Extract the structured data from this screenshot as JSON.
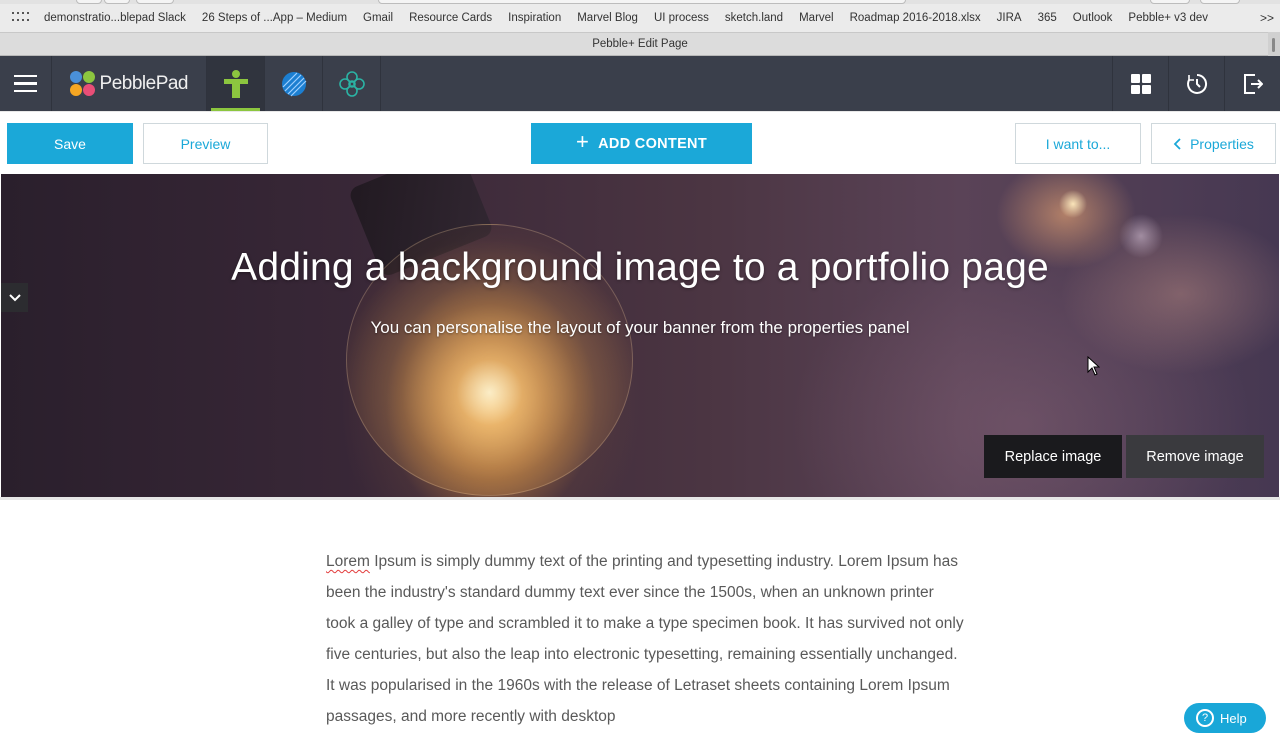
{
  "browser": {
    "bookmarks": [
      "demonstratio...blepad Slack",
      "26 Steps of ...App – Medium",
      "Gmail",
      "Resource Cards",
      "Inspiration",
      "Marvel Blog",
      "UI process",
      "sketch.land",
      "Marvel",
      "Roadmap 2016-2018.xlsx",
      "JIRA",
      "365",
      "Outlook",
      "Pebble+ v3 dev"
    ],
    "more": ">>",
    "tab_title": "Pebble+ Edit Page"
  },
  "header": {
    "logo_text": "PebblePad",
    "logo_colors": [
      "#4a90d9",
      "#8cc63f",
      "#f5a623",
      "#e94e77"
    ],
    "icons": [
      "hamburger-icon",
      "person-icon",
      "globe-icon",
      "flower-icon",
      "grid-icon",
      "history-icon",
      "logout-icon"
    ]
  },
  "toolbar": {
    "save": "Save",
    "preview": "Preview",
    "add_content": "ADD CONTENT",
    "i_want_to": "I want to...",
    "properties": "Properties"
  },
  "banner": {
    "title": "Adding a background image to a portfolio page",
    "subtitle": "You can personalise the layout of your banner from the properties panel",
    "replace_image": "Replace image",
    "remove_image": "Remove image"
  },
  "content": {
    "first_word": "Lorem",
    "body": " Ipsum is simply dummy text of the printing and typesetting industry. Lorem Ipsum has been the industry's standard dummy text ever since the 1500s, when an unknown printer took a galley of type and scrambled it to make a type specimen book. It has survived not only five centuries, but also the leap into electronic typesetting, remaining essentially unchanged. It was popularised in the 1960s with the release of Letraset sheets containing Lorem Ipsum passages, and more recently with desktop"
  },
  "help": {
    "label": "Help"
  },
  "colors": {
    "accent": "#1ba8d8",
    "header_bg": "#3a3f4b",
    "active_tab": "#8cc63f"
  }
}
